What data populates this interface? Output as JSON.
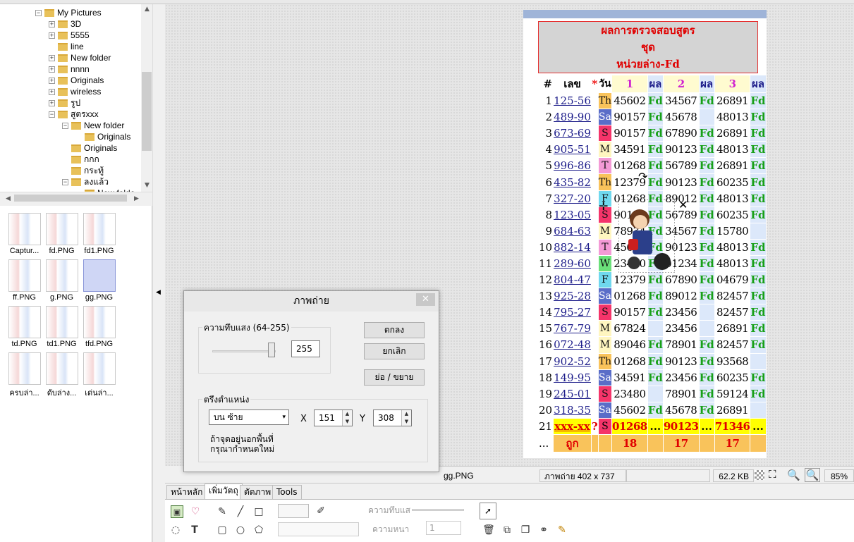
{
  "tree": {
    "items": [
      {
        "label": "My Pictures",
        "expander": "⊟",
        "depth": 0
      },
      {
        "label": "3D",
        "expander": "⊞",
        "depth": 1
      },
      {
        "label": "5555",
        "expander": "⊞",
        "depth": 1
      },
      {
        "label": "line",
        "expander": "",
        "depth": 1
      },
      {
        "label": "New folder",
        "expander": "⊞",
        "depth": 1
      },
      {
        "label": "nnnn",
        "expander": "⊞",
        "depth": 1
      },
      {
        "label": "Originals",
        "expander": "⊞",
        "depth": 1
      },
      {
        "label": "wireless",
        "expander": "⊞",
        "depth": 1
      },
      {
        "label": "รูป",
        "expander": "⊞",
        "depth": 1
      },
      {
        "label": "สูตรxxx",
        "expander": "⊟",
        "depth": 1
      },
      {
        "label": "New folder",
        "expander": "⊟",
        "depth": 2
      },
      {
        "label": "Originals",
        "expander": "",
        "depth": 3
      },
      {
        "label": "Originals",
        "expander": "",
        "depth": 2
      },
      {
        "label": "กกก",
        "expander": "",
        "depth": 2
      },
      {
        "label": "กระทู้",
        "expander": "",
        "depth": 2
      },
      {
        "label": "ลงแล้ว",
        "expander": "⊟",
        "depth": 2
      },
      {
        "label": "New folde",
        "expander": "",
        "depth": 3
      }
    ]
  },
  "thumbnails": [
    "Captur...",
    "fd.PNG",
    "fd1.PNG",
    "ff.PNG",
    "g.PNG",
    "gg.PNG",
    "td.PNG",
    "td1.PNG",
    "tfd.PNG",
    "ครบล่า...",
    "ดับล่าง...",
    "เด่นล่า..."
  ],
  "selected_thumbnail": "gg.PNG",
  "document": {
    "header_line1": "ผลการตรวจสอบสูตร",
    "header_line2": "ชุด",
    "header_line3": "หน่วยล่าง-Fd",
    "col_idx": "#",
    "col_num": "เลข",
    "col_star": "*",
    "col_day": "วัน",
    "col_1": "1",
    "col_res1": "ผล",
    "col_2": "2",
    "col_res2": "ผล",
    "col_3": "3",
    "col_res3": "ผล",
    "rows": [
      [
        "1",
        "125-56",
        "Th",
        "45602",
        "Fd",
        "34567",
        "Fd",
        "26891",
        "Fd"
      ],
      [
        "2",
        "489-90",
        "Sa",
        "90157",
        "Fd",
        "45678",
        "",
        "48013",
        "Fd"
      ],
      [
        "3",
        "673-69",
        "S",
        "90157",
        "Fd",
        "67890",
        "Fd",
        "26891",
        "Fd"
      ],
      [
        "4",
        "905-51",
        "M",
        "34591",
        "Fd",
        "90123",
        "Fd",
        "48013",
        "Fd"
      ],
      [
        "5",
        "996-86",
        "T",
        "01268",
        "Fd",
        "56789",
        "Fd",
        "26891",
        "Fd"
      ],
      [
        "6",
        "435-82",
        "Th",
        "12379",
        "Fd",
        "90123",
        "Fd",
        "60235",
        "Fd"
      ],
      [
        "7",
        "327-20",
        "F",
        "01268",
        "Fd",
        "89012",
        "Fd",
        "48013",
        "Fd"
      ],
      [
        "8",
        "123-05",
        "S",
        "90157",
        "Fd",
        "56789",
        "Fd",
        "60235",
        "Fd"
      ],
      [
        "9",
        "684-63",
        "M",
        "78934",
        "Fd",
        "34567",
        "Fd",
        "15780",
        ""
      ],
      [
        "10",
        "882-14",
        "T",
        "45602",
        "Fd",
        "90123",
        "Fd",
        "48013",
        "Fd"
      ],
      [
        "11",
        "289-60",
        "W",
        "23480",
        "Fd",
        "01234",
        "Fd",
        "48013",
        "Fd"
      ],
      [
        "12",
        "804-47",
        "F",
        "12379",
        "Fd",
        "67890",
        "Fd",
        "04679",
        "Fd"
      ],
      [
        "13",
        "925-28",
        "Sa",
        "01268",
        "Fd",
        "89012",
        "Fd",
        "82457",
        "Fd"
      ],
      [
        "14",
        "795-27",
        "S",
        "90157",
        "Fd",
        "23456",
        "",
        "82457",
        "Fd"
      ],
      [
        "15",
        "767-79",
        "M",
        "67824",
        "",
        "23456",
        "",
        "26891",
        "Fd"
      ],
      [
        "16",
        "072-48",
        "M",
        "89046",
        "Fd",
        "78901",
        "Fd",
        "82457",
        "Fd"
      ],
      [
        "17",
        "902-52",
        "Th",
        "01268",
        "Fd",
        "90123",
        "Fd",
        "93568",
        ""
      ],
      [
        "18",
        "149-95",
        "Sa",
        "34591",
        "Fd",
        "23456",
        "Fd",
        "60235",
        "Fd"
      ],
      [
        "19",
        "245-01",
        "S",
        "23480",
        "",
        "78901",
        "Fd",
        "59124",
        "Fd"
      ],
      [
        "20",
        "318-35",
        "Sa",
        "45602",
        "Fd",
        "45678",
        "Fd",
        "26891",
        ""
      ]
    ],
    "row21": [
      "21",
      "xxx-xx",
      "?",
      "S",
      "01268",
      "...",
      "90123",
      "...",
      "71346",
      "..."
    ],
    "footer": {
      "dots": "...",
      "label": "ถูก",
      "c1": "18",
      "c2": "17",
      "c3": "17"
    }
  },
  "dialog": {
    "title": "ภาพถ่าย",
    "close": "✕",
    "opacity_group": "ความทึบแสง (64-255)",
    "opacity_value": "255",
    "ok": "ตกลง",
    "cancel": "ยกเลิก",
    "resize": "ย่อ / ขยาย",
    "position_group": "ตรึงตำแหน่ง",
    "position_value": "บน ซ้าย",
    "x_label": "X",
    "x_value": "151",
    "y_label": "Y",
    "y_value": "308",
    "note_line1": "ถ้าจุดอยู่นอกพื้นที่",
    "note_line2": "กรุณากำหนดใหม่"
  },
  "status": {
    "filename": "gg.PNG",
    "image_info": "ภาพถ่าย 402 x 737",
    "size": "62.2 KB",
    "zoom": "85%"
  },
  "tabs": [
    "หน้าหลัก",
    "เพิ่มวัตถุ",
    "ตัดภาพ",
    "Tools"
  ],
  "active_tab": "เพิ่มวัตถุ",
  "ribbon": {
    "opacity_label": "ความทึบแส",
    "thickness_label": "ความหนา",
    "thickness_value": "1"
  },
  "colors": {
    "accent_red": "#e00000",
    "fd_green": "#18a018",
    "header_gray": "#d4d4d4",
    "highlight_yellow": "#ffff00",
    "footer_gold": "#f9c35b"
  }
}
